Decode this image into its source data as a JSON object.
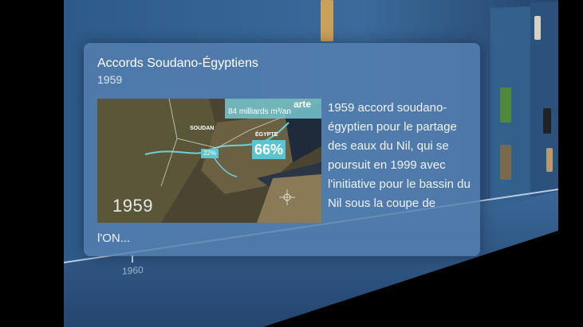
{
  "card": {
    "title": "Accords Soudano-Égyptiens",
    "year": "1959",
    "image": {
      "year_overlay": "1959",
      "header_text": "84 milliards m³/an",
      "brand": "arte",
      "label_soudan": "SOUDAN",
      "label_egypte": "ÉGYPTE",
      "pct_egypte": "66%",
      "pct_soudan": "22%"
    },
    "body_text": "1959  accord soudano-égyptien pour le partage des eaux du Nil, qui se poursuit en 1999 avec l'initiative pour le bassin du Nil sous la coupe de",
    "body_continuation": "l'ON..."
  },
  "timeline": {
    "year_label": "1960"
  },
  "colors": {
    "card_bg": "#5680b0",
    "accent_teal": "#5bc4cf",
    "panel_blue": "#3d6b9c"
  }
}
